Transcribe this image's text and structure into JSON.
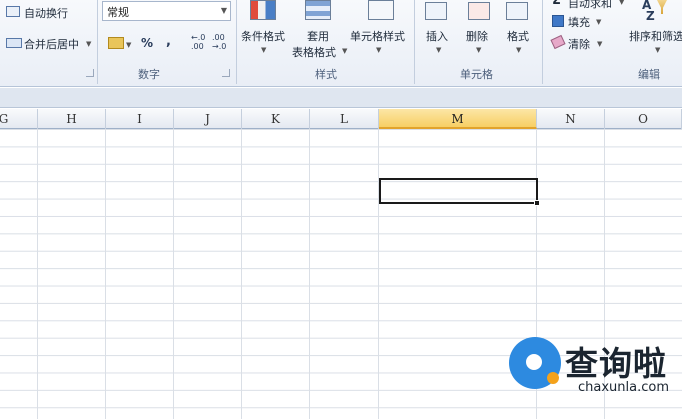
{
  "ribbon": {
    "alignment": {
      "wrap_text": "自动换行",
      "merge_center": "合并后居中"
    },
    "number": {
      "format_value": "常规",
      "percent": "%",
      "comma": ",",
      "increase_decimal": "←.0\n.00",
      "decrease_decimal": ".00\n→.0",
      "group_label": "数字"
    },
    "styles": {
      "conditional_format": "条件格式",
      "table_format_line1": "套用",
      "table_format_line2": "表格格式",
      "cell_styles": "单元格样式",
      "group_label": "样式"
    },
    "cells": {
      "insert": "插入",
      "delete": "删除",
      "format": "格式",
      "group_label": "单元格"
    },
    "editing": {
      "autosum": "自动求和",
      "fill": "填充",
      "clear": "清除",
      "sort_filter": "排序和筛选",
      "group_label": "编辑"
    }
  },
  "columns": [
    "G",
    "H",
    "I",
    "J",
    "K",
    "L",
    "M",
    "N",
    "O"
  ],
  "selected_column": "M",
  "watermark": {
    "cn": "查询啦",
    "en": "chaxunla.com"
  },
  "colors": {
    "selected_header": "#f7cf64",
    "gridline": "#dadfe6",
    "watermark_blue": "#2d8ae0",
    "watermark_orange": "#f4a21b"
  }
}
